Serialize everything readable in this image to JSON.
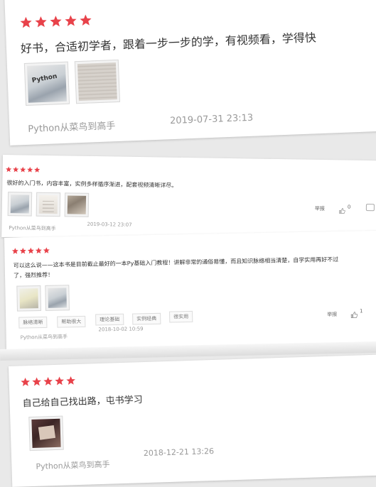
{
  "colors": {
    "star": "#e8424a",
    "meta": "#999999"
  },
  "reviews": [
    {
      "stars": 5,
      "text": "好书，合适初学者，跟着一步一步的学，有视频看，学得快",
      "product": "Python从菜鸟到高手",
      "date": "2019-07-31 23:13"
    },
    {
      "stars": 5,
      "text": "很好的入门书，内容丰富，实例多样循序渐进，配套视频清晰详尽。",
      "product": "Python从菜鸟到高手",
      "date": "2019-03-12 23:07",
      "report_label": "举报",
      "like_count": "0"
    },
    {
      "stars": 5,
      "text_line1": "可以这么说——这本书是目前截止最好的一本Py基础入门教程！讲解非常的通俗易懂，而且知识脉络相当清楚，自学实用再好不过",
      "text_line2": "了，强烈推荐！",
      "tags": [
        "脉络清晰",
        "帮助很大",
        "理论基础",
        "实例经典",
        "很实用"
      ],
      "product": "Python从菜鸟到高手",
      "date": "2018-10-02 10:59",
      "report_label": "举报",
      "like_count": "1"
    },
    {
      "stars": 5,
      "text": "自己给自己找出路，屯书学习",
      "product": "Python从菜鸟到高手",
      "date": "2018-12-21 13:26"
    }
  ],
  "thumb_labels": {
    "python_cover": "Python"
  }
}
